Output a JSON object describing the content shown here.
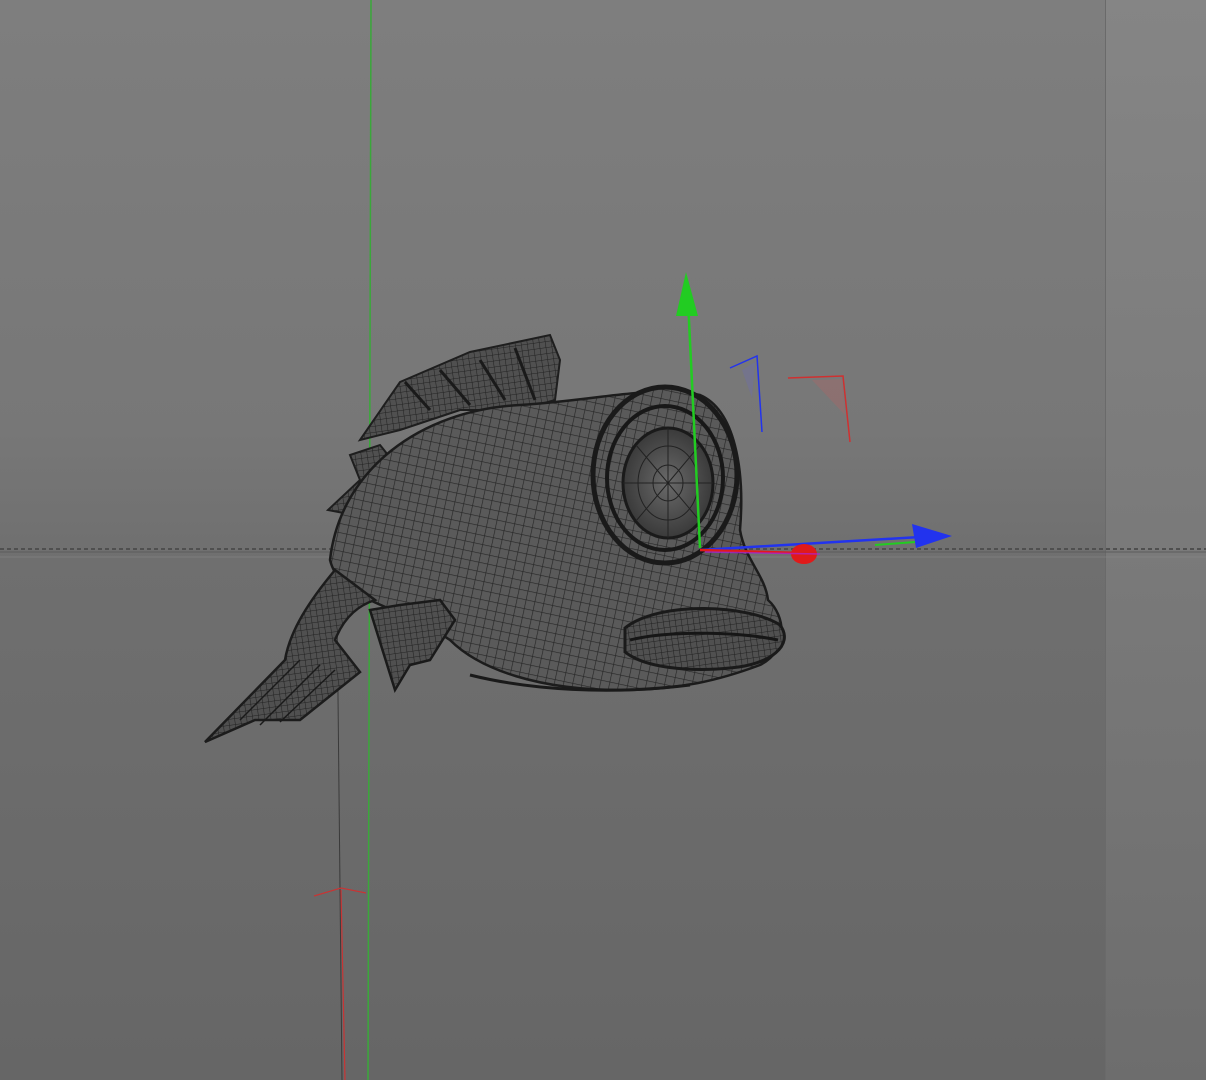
{
  "viewport": {
    "mode": "wireframe",
    "background_color": "#787878",
    "grid_axis_colors": {
      "y_axis": "#2f9a2f",
      "x_axis": "#cc3333",
      "horizon": "#5a5a5a"
    }
  },
  "scene_object": {
    "kind": "fish",
    "mesh_color": "#2b2b2b",
    "selected": true
  },
  "gizmo": {
    "tool": "move",
    "colors": {
      "x": "#e01a1a",
      "y": "#22cc22",
      "z": "#2233ee"
    }
  },
  "icons": {
    "move_handle_y": "arrow-up-icon",
    "move_handle_z": "arrow-right-icon",
    "move_handle_x": "sphere-handle-icon",
    "plane_handle_yz": "plane-handle-icon",
    "plane_handle_xy": "plane-handle-icon"
  }
}
